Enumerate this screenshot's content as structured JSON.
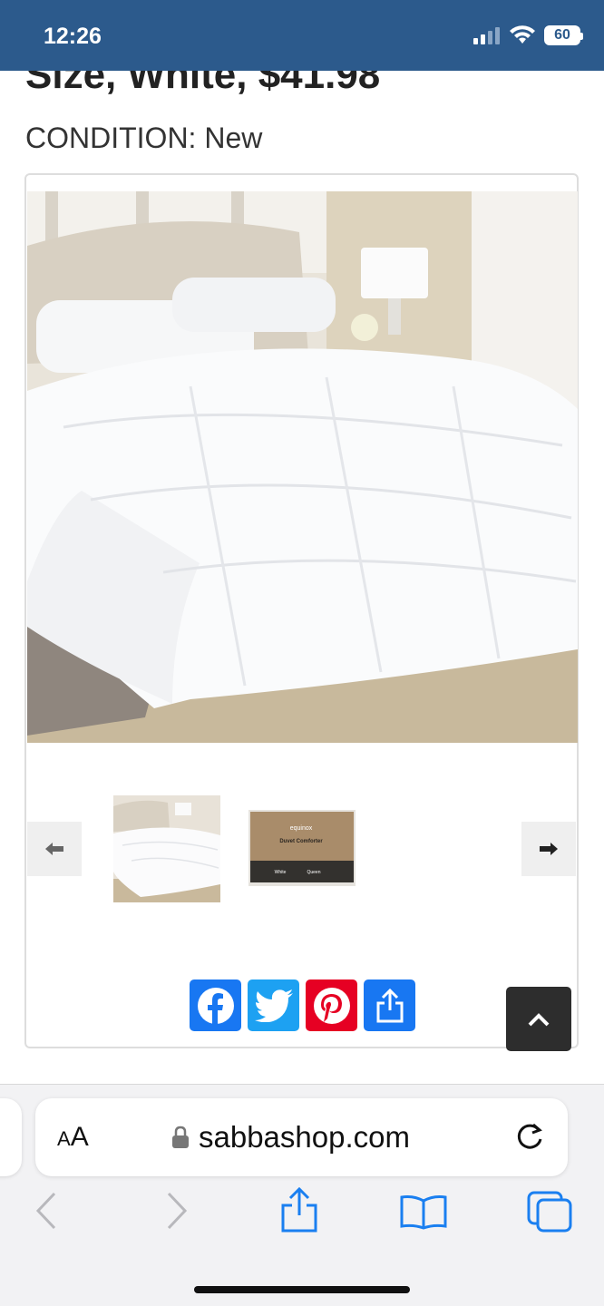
{
  "status_bar": {
    "time": "12:26",
    "battery": "60"
  },
  "product": {
    "title_partial": "Size, White, $41.98",
    "condition": "CONDITION: New"
  },
  "gallery": {
    "thumbnails": [
      "comforter-bed-photo",
      "comforter-box-photo"
    ],
    "thumb2_box_text": [
      "equinox",
      "Duvet Comforter",
      "White",
      "Queen"
    ]
  },
  "share": {
    "buttons": [
      "facebook",
      "twitter",
      "pinterest",
      "share"
    ]
  },
  "browser": {
    "aa_label_big": "A",
    "aa_label_small_first": "A",
    "url": "sabbashop.com"
  },
  "colors": {
    "status_bar": "#2c5a8c",
    "facebook": "#1877f2",
    "twitter": "#1da1f2",
    "pinterest": "#e60023",
    "safari_blue": "#1a7ff0"
  }
}
